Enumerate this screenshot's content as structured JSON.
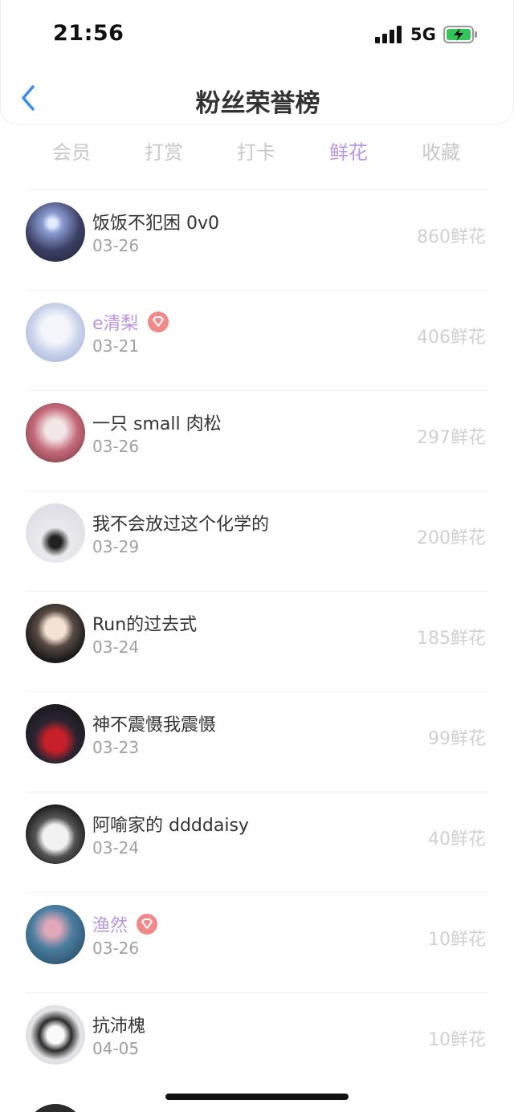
{
  "status": {
    "time": "21:56",
    "network": "5G"
  },
  "header": {
    "title": "粉丝荣誉榜"
  },
  "tabs": [
    {
      "label": "会员"
    },
    {
      "label": "打赏"
    },
    {
      "label": "打卡"
    },
    {
      "label": "鲜花",
      "active": true
    },
    {
      "label": "收藏"
    }
  ],
  "fans": [
    {
      "name": "饭饭不犯困 0v0",
      "date": "03-26",
      "amount": "860鲜花",
      "vip": false
    },
    {
      "name": "e清梨",
      "date": "03-21",
      "amount": "406鲜花",
      "vip": true
    },
    {
      "name": "一只 small 肉松",
      "date": "03-26",
      "amount": "297鲜花",
      "vip": false
    },
    {
      "name": "我不会放过这个化学的",
      "date": "03-29",
      "amount": "200鲜花",
      "vip": false
    },
    {
      "name": "Run的过去式",
      "date": "03-24",
      "amount": "185鲜花",
      "vip": false
    },
    {
      "name": "神不震慑我震慑",
      "date": "03-23",
      "amount": "99鲜花",
      "vip": false
    },
    {
      "name": "阿喻家的 ddddaisy",
      "date": "03-24",
      "amount": "40鲜花",
      "vip": false
    },
    {
      "name": "渔然",
      "date": "03-26",
      "amount": "10鲜花",
      "vip": true
    },
    {
      "name": "抗沛槐",
      "date": "04-05",
      "amount": "10鲜花",
      "vip": false
    }
  ],
  "colors": {
    "accent": "#b898e2",
    "badge": "#f08a8a",
    "muted": "#d0d0d0"
  }
}
